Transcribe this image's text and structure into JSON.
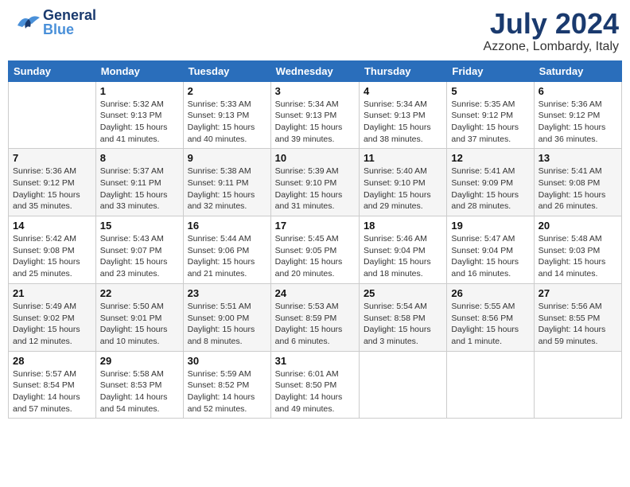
{
  "header": {
    "logo_general": "General",
    "logo_blue": "Blue",
    "month": "July 2024",
    "location": "Azzone, Lombardy, Italy"
  },
  "columns": [
    "Sunday",
    "Monday",
    "Tuesday",
    "Wednesday",
    "Thursday",
    "Friday",
    "Saturday"
  ],
  "weeks": [
    [
      {
        "day": "",
        "info": ""
      },
      {
        "day": "1",
        "info": "Sunrise: 5:32 AM\nSunset: 9:13 PM\nDaylight: 15 hours\nand 41 minutes."
      },
      {
        "day": "2",
        "info": "Sunrise: 5:33 AM\nSunset: 9:13 PM\nDaylight: 15 hours\nand 40 minutes."
      },
      {
        "day": "3",
        "info": "Sunrise: 5:34 AM\nSunset: 9:13 PM\nDaylight: 15 hours\nand 39 minutes."
      },
      {
        "day": "4",
        "info": "Sunrise: 5:34 AM\nSunset: 9:13 PM\nDaylight: 15 hours\nand 38 minutes."
      },
      {
        "day": "5",
        "info": "Sunrise: 5:35 AM\nSunset: 9:12 PM\nDaylight: 15 hours\nand 37 minutes."
      },
      {
        "day": "6",
        "info": "Sunrise: 5:36 AM\nSunset: 9:12 PM\nDaylight: 15 hours\nand 36 minutes."
      }
    ],
    [
      {
        "day": "7",
        "info": "Sunrise: 5:36 AM\nSunset: 9:12 PM\nDaylight: 15 hours\nand 35 minutes."
      },
      {
        "day": "8",
        "info": "Sunrise: 5:37 AM\nSunset: 9:11 PM\nDaylight: 15 hours\nand 33 minutes."
      },
      {
        "day": "9",
        "info": "Sunrise: 5:38 AM\nSunset: 9:11 PM\nDaylight: 15 hours\nand 32 minutes."
      },
      {
        "day": "10",
        "info": "Sunrise: 5:39 AM\nSunset: 9:10 PM\nDaylight: 15 hours\nand 31 minutes."
      },
      {
        "day": "11",
        "info": "Sunrise: 5:40 AM\nSunset: 9:10 PM\nDaylight: 15 hours\nand 29 minutes."
      },
      {
        "day": "12",
        "info": "Sunrise: 5:41 AM\nSunset: 9:09 PM\nDaylight: 15 hours\nand 28 minutes."
      },
      {
        "day": "13",
        "info": "Sunrise: 5:41 AM\nSunset: 9:08 PM\nDaylight: 15 hours\nand 26 minutes."
      }
    ],
    [
      {
        "day": "14",
        "info": "Sunrise: 5:42 AM\nSunset: 9:08 PM\nDaylight: 15 hours\nand 25 minutes."
      },
      {
        "day": "15",
        "info": "Sunrise: 5:43 AM\nSunset: 9:07 PM\nDaylight: 15 hours\nand 23 minutes."
      },
      {
        "day": "16",
        "info": "Sunrise: 5:44 AM\nSunset: 9:06 PM\nDaylight: 15 hours\nand 21 minutes."
      },
      {
        "day": "17",
        "info": "Sunrise: 5:45 AM\nSunset: 9:05 PM\nDaylight: 15 hours\nand 20 minutes."
      },
      {
        "day": "18",
        "info": "Sunrise: 5:46 AM\nSunset: 9:04 PM\nDaylight: 15 hours\nand 18 minutes."
      },
      {
        "day": "19",
        "info": "Sunrise: 5:47 AM\nSunset: 9:04 PM\nDaylight: 15 hours\nand 16 minutes."
      },
      {
        "day": "20",
        "info": "Sunrise: 5:48 AM\nSunset: 9:03 PM\nDaylight: 15 hours\nand 14 minutes."
      }
    ],
    [
      {
        "day": "21",
        "info": "Sunrise: 5:49 AM\nSunset: 9:02 PM\nDaylight: 15 hours\nand 12 minutes."
      },
      {
        "day": "22",
        "info": "Sunrise: 5:50 AM\nSunset: 9:01 PM\nDaylight: 15 hours\nand 10 minutes."
      },
      {
        "day": "23",
        "info": "Sunrise: 5:51 AM\nSunset: 9:00 PM\nDaylight: 15 hours\nand 8 minutes."
      },
      {
        "day": "24",
        "info": "Sunrise: 5:53 AM\nSunset: 8:59 PM\nDaylight: 15 hours\nand 6 minutes."
      },
      {
        "day": "25",
        "info": "Sunrise: 5:54 AM\nSunset: 8:58 PM\nDaylight: 15 hours\nand 3 minutes."
      },
      {
        "day": "26",
        "info": "Sunrise: 5:55 AM\nSunset: 8:56 PM\nDaylight: 15 hours\nand 1 minute."
      },
      {
        "day": "27",
        "info": "Sunrise: 5:56 AM\nSunset: 8:55 PM\nDaylight: 14 hours\nand 59 minutes."
      }
    ],
    [
      {
        "day": "28",
        "info": "Sunrise: 5:57 AM\nSunset: 8:54 PM\nDaylight: 14 hours\nand 57 minutes."
      },
      {
        "day": "29",
        "info": "Sunrise: 5:58 AM\nSunset: 8:53 PM\nDaylight: 14 hours\nand 54 minutes."
      },
      {
        "day": "30",
        "info": "Sunrise: 5:59 AM\nSunset: 8:52 PM\nDaylight: 14 hours\nand 52 minutes."
      },
      {
        "day": "31",
        "info": "Sunrise: 6:01 AM\nSunset: 8:50 PM\nDaylight: 14 hours\nand 49 minutes."
      },
      {
        "day": "",
        "info": ""
      },
      {
        "day": "",
        "info": ""
      },
      {
        "day": "",
        "info": ""
      }
    ]
  ]
}
